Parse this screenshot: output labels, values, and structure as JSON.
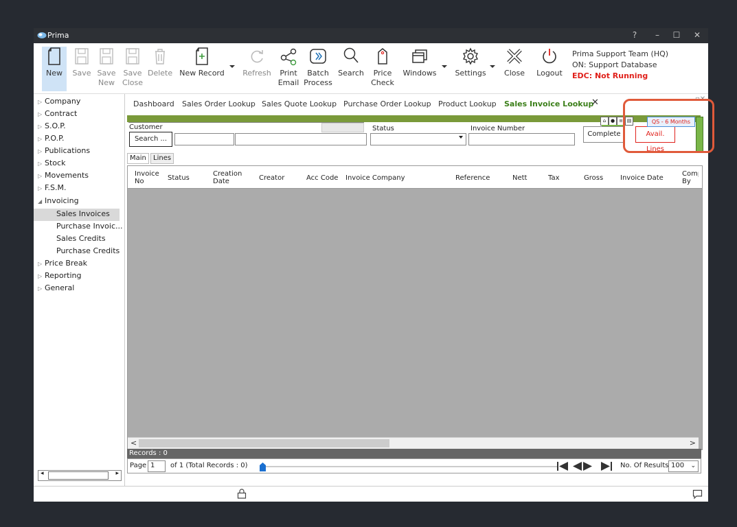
{
  "window": {
    "title": "Prima",
    "controls": {
      "help": "?",
      "minimize": "–",
      "maximize": "☐",
      "close": "✕"
    }
  },
  "ribbon": {
    "new": "New",
    "save": "Save",
    "save_new_1": "Save",
    "save_new_2": "New",
    "save_close_1": "Save",
    "save_close_2": "Close",
    "delete": "Delete",
    "new_record": "New Record",
    "refresh": "Refresh",
    "print_email_1": "Print",
    "print_email_2": "Email",
    "batch_process_1": "Batch",
    "batch_process_2": "Process",
    "search": "Search",
    "price_check_1": "Price",
    "price_check_2": "Check",
    "windows": "Windows",
    "settings": "Settings",
    "close": "Close",
    "logout": "Logout"
  },
  "info": {
    "team": "Prima Support Team (HQ)",
    "database": "ON: Support Database",
    "edc": "EDC: Not Running"
  },
  "sidebar": {
    "items": [
      {
        "label": "Company"
      },
      {
        "label": "Contract"
      },
      {
        "label": "S.O.P."
      },
      {
        "label": "P.O.P."
      },
      {
        "label": "Publications"
      },
      {
        "label": "Stock"
      },
      {
        "label": "Movements"
      },
      {
        "label": "F.S.M."
      },
      {
        "label": "Invoicing"
      },
      {
        "label": "Sales Invoices"
      },
      {
        "label": "Purchase Invoic..."
      },
      {
        "label": "Sales Credits"
      },
      {
        "label": "Purchase Credits"
      },
      {
        "label": "Price Break"
      },
      {
        "label": "Reporting"
      },
      {
        "label": "General"
      }
    ]
  },
  "tabs": {
    "dashboard": "Dashboard",
    "sales_order": "Sales Order Lookup",
    "sales_quote": "Sales Quote Lookup",
    "purchase_order": "Purchase Order Lookup",
    "product": "Product Lookup",
    "sales_invoice": "Sales Invoice Lookup"
  },
  "filters": {
    "customer_label": "Customer",
    "search_btn": "Search ...",
    "status_label": "Status",
    "invoice_number_label": "Invoice Number",
    "complete_btn": "Complete",
    "avail_lines_btn": "Avail. Lines",
    "qs_badge": "QS - 6 Months"
  },
  "subtabs": {
    "main": "Main",
    "lines": "Lines"
  },
  "grid": {
    "columns": [
      {
        "l1": "Invoice",
        "l2": "No"
      },
      {
        "l1": "Status",
        "l2": ""
      },
      {
        "l1": "Creation",
        "l2": "Date"
      },
      {
        "l1": "Creator",
        "l2": ""
      },
      {
        "l1": "Acc Code",
        "l2": ""
      },
      {
        "l1": "Invoice Company",
        "l2": ""
      },
      {
        "l1": "Reference",
        "l2": ""
      },
      {
        "l1": "Nett",
        "l2": ""
      },
      {
        "l1": "Tax",
        "l2": ""
      },
      {
        "l1": "Gross",
        "l2": ""
      },
      {
        "l1": "Invoice Date",
        "l2": ""
      },
      {
        "l1": "Comp",
        "l2": "By"
      }
    ]
  },
  "footer": {
    "records": "Records : 0",
    "page_label": "Page",
    "page_value": "1",
    "of_total": "of  1  (Total Records : 0)",
    "results_label": "No. Of Results",
    "results_value": "100"
  }
}
